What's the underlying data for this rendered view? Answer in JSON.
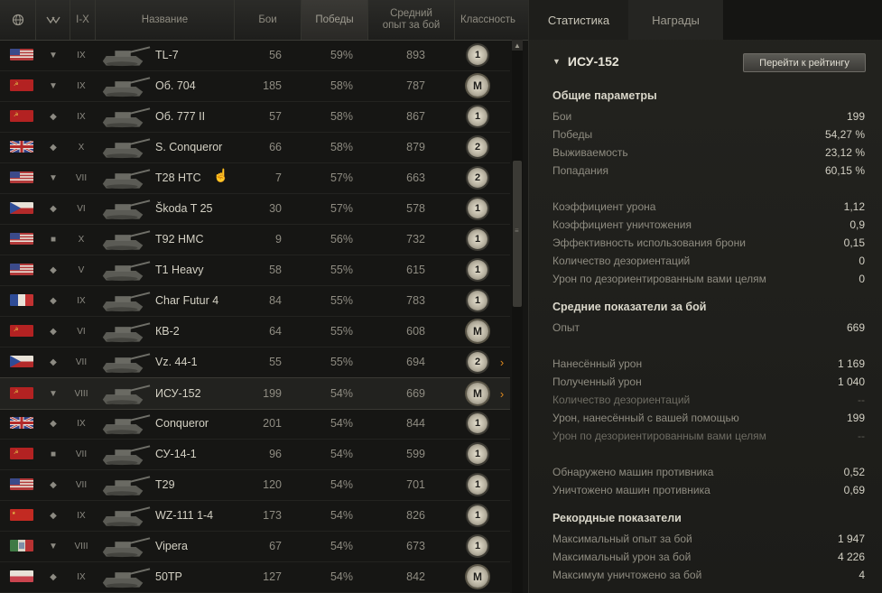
{
  "header": {
    "tier_range": "I-X",
    "name": "Название",
    "battles": "Бои",
    "wins": "Победы",
    "avg_xp": "Средний опыт за бой",
    "mastery": "Классность"
  },
  "rows": [
    {
      "flag": "usa",
      "type": "heavy",
      "tier": "IX",
      "name": "TL-7",
      "battles": "56",
      "wins": "59%",
      "xp": "893",
      "badge": "1",
      "arrow": ""
    },
    {
      "flag": "ussr",
      "type": "heavy",
      "tier": "IX",
      "name": "Об. 704",
      "battles": "185",
      "wins": "58%",
      "xp": "787",
      "badge": "M",
      "arrow": ""
    },
    {
      "flag": "ussr",
      "type": "medium",
      "tier": "IX",
      "name": "Об. 777 II",
      "battles": "57",
      "wins": "58%",
      "xp": "867",
      "badge": "1",
      "arrow": ""
    },
    {
      "flag": "uk",
      "type": "medium",
      "tier": "X",
      "name": "S. Conqueror",
      "battles": "66",
      "wins": "58%",
      "xp": "879",
      "badge": "2",
      "arrow": ""
    },
    {
      "flag": "usa",
      "type": "heavy",
      "tier": "VII",
      "name": "T28 HTC",
      "battles": "7",
      "wins": "57%",
      "xp": "663",
      "badge": "2",
      "arrow": ""
    },
    {
      "flag": "czech",
      "type": "light",
      "tier": "VI",
      "name": "Škoda T 25",
      "battles": "30",
      "wins": "57%",
      "xp": "578",
      "badge": "1",
      "arrow": ""
    },
    {
      "flag": "usa",
      "type": "spg",
      "tier": "X",
      "name": "T92 HMC",
      "battles": "9",
      "wins": "56%",
      "xp": "732",
      "badge": "1",
      "arrow": ""
    },
    {
      "flag": "usa",
      "type": "medium",
      "tier": "V",
      "name": "T1 Heavy",
      "battles": "58",
      "wins": "55%",
      "xp": "615",
      "badge": "1",
      "arrow": ""
    },
    {
      "flag": "france",
      "type": "light",
      "tier": "IX",
      "name": "Char Futur 4",
      "battles": "84",
      "wins": "55%",
      "xp": "783",
      "badge": "1",
      "arrow": ""
    },
    {
      "flag": "ussr",
      "type": "medium",
      "tier": "VI",
      "name": "КВ-2",
      "battles": "64",
      "wins": "55%",
      "xp": "608",
      "badge": "M",
      "arrow": ""
    },
    {
      "flag": "czech",
      "type": "medium",
      "tier": "VII",
      "name": "Vz. 44-1",
      "battles": "55",
      "wins": "55%",
      "xp": "694",
      "badge": "2",
      "arrow": "›"
    },
    {
      "flag": "ussr",
      "type": "heavy",
      "tier": "VIII",
      "name": "ИСУ-152",
      "battles": "199",
      "wins": "54%",
      "xp": "669",
      "badge": "M",
      "arrow": "›"
    },
    {
      "flag": "uk",
      "type": "medium",
      "tier": "IX",
      "name": "Conqueror",
      "battles": "201",
      "wins": "54%",
      "xp": "844",
      "badge": "1",
      "arrow": ""
    },
    {
      "flag": "ussr",
      "type": "spg",
      "tier": "VII",
      "name": "СУ-14-1",
      "battles": "96",
      "wins": "54%",
      "xp": "599",
      "badge": "1",
      "arrow": ""
    },
    {
      "flag": "usa",
      "type": "medium",
      "tier": "VII",
      "name": "T29",
      "battles": "120",
      "wins": "54%",
      "xp": "701",
      "badge": "1",
      "arrow": ""
    },
    {
      "flag": "china",
      "type": "medium",
      "tier": "IX",
      "name": "WZ-111 1-4",
      "battles": "173",
      "wins": "54%",
      "xp": "826",
      "badge": "1",
      "arrow": ""
    },
    {
      "flag": "italy",
      "type": "heavy",
      "tier": "VIII",
      "name": "Vipera",
      "battles": "67",
      "wins": "54%",
      "xp": "673",
      "badge": "1",
      "arrow": ""
    },
    {
      "flag": "poland",
      "type": "medium",
      "tier": "IX",
      "name": "50TP",
      "battles": "127",
      "wins": "54%",
      "xp": "842",
      "badge": "M",
      "arrow": ""
    }
  ],
  "right": {
    "tabs": [
      "Статистика",
      "Награды"
    ],
    "vehicle": "ИСУ-152",
    "rating_button": "Перейти к рейтингу",
    "sections": [
      {
        "title": "Общие параметры",
        "items": [
          {
            "label": "Бои",
            "value": "199"
          },
          {
            "label": "Победы",
            "value": "54,27 %"
          },
          {
            "label": "Выживаемость",
            "value": "23,12 %"
          },
          {
            "label": "Попадания",
            "value": "60,15 %"
          },
          {
            "label": "Коэффициент урона",
            "value": "1,12"
          },
          {
            "label": "Коэффициент уничтожения",
            "value": "0,9"
          },
          {
            "label": "Эффективность использования брони",
            "value": "0,15"
          },
          {
            "label": "Количество дезориентаций",
            "value": "0"
          },
          {
            "label": "Урон по дезориентированным вами целям",
            "value": "0"
          }
        ]
      },
      {
        "title": "Средние показатели за бой",
        "items": [
          {
            "label": "Опыт",
            "value": "669"
          },
          {
            "label": "Нанесённый урон",
            "value": "1 169"
          },
          {
            "label": "Полученный урон",
            "value": "1 040"
          },
          {
            "label": "Количество дезориентаций",
            "value": "--"
          },
          {
            "label": "Урон, нанесённый с вашей помощью",
            "value": "199"
          },
          {
            "label": "Урон по дезориентированным вами целям",
            "value": "--"
          },
          {
            "label": "Обнаружено машин противника",
            "value": "0,52"
          },
          {
            "label": "Уничтожено машин противника",
            "value": "0,69"
          }
        ]
      },
      {
        "title": "Рекордные показатели",
        "items": [
          {
            "label": "Максимальный опыт за бой",
            "value": "1 947"
          },
          {
            "label": "Максимальный урон за бой",
            "value": "4 226"
          },
          {
            "label": "Максимум уничтожено за бой",
            "value": "4"
          }
        ]
      }
    ]
  }
}
